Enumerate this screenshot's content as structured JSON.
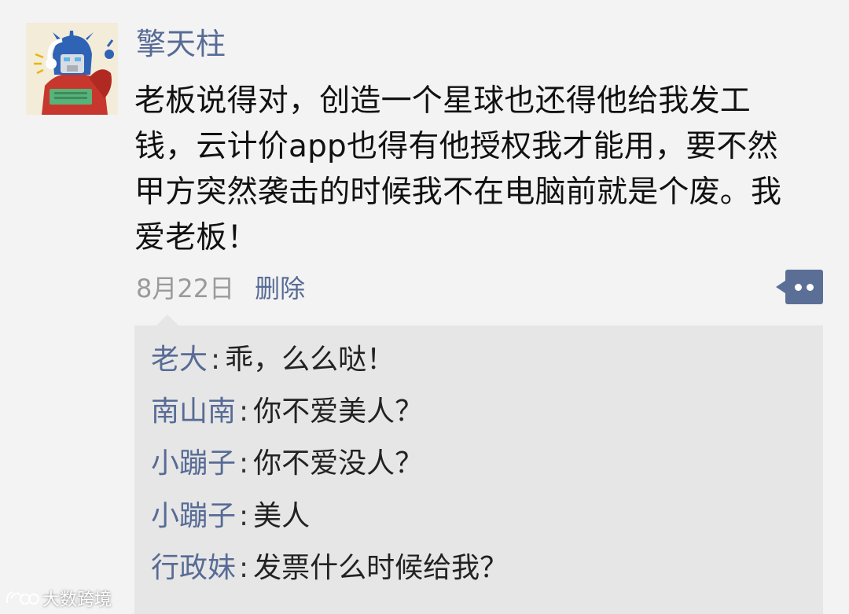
{
  "post": {
    "username": "擎天柱",
    "text_lines": [
      "老板说得对，创造一个星球也还得他给我发工",
      "钱，云计价app也得有他授权我才能用，要不然",
      "甲方突然袭击的时候我不在电脑前就是个废。我",
      "爱老板！"
    ],
    "date": "8月22日",
    "delete_label": "删除",
    "more_icon": "more-dots-icon",
    "avatar_icon": "robot-avatar"
  },
  "comments": [
    {
      "author": "老大",
      "separator": ":",
      "text": "乖，么么哒！"
    },
    {
      "author": "南山南",
      "separator": ":",
      "text": "你不爱美人？"
    },
    {
      "author": "小蹦子",
      "separator": ":",
      "text": "你不爱没人？"
    },
    {
      "author": "小蹦子",
      "separator": ":",
      "text": "美人"
    },
    {
      "author": "行政妹",
      "separator": ":",
      "text": "发票什么时候给我？"
    }
  ],
  "watermark": {
    "text": "大数跨境",
    "logo_icon": "watermark-logo"
  },
  "colors": {
    "link": "#576b95",
    "background": "#f3f3f3",
    "comment_background": "#e6e6e6",
    "more_button": "#5b6f96"
  }
}
